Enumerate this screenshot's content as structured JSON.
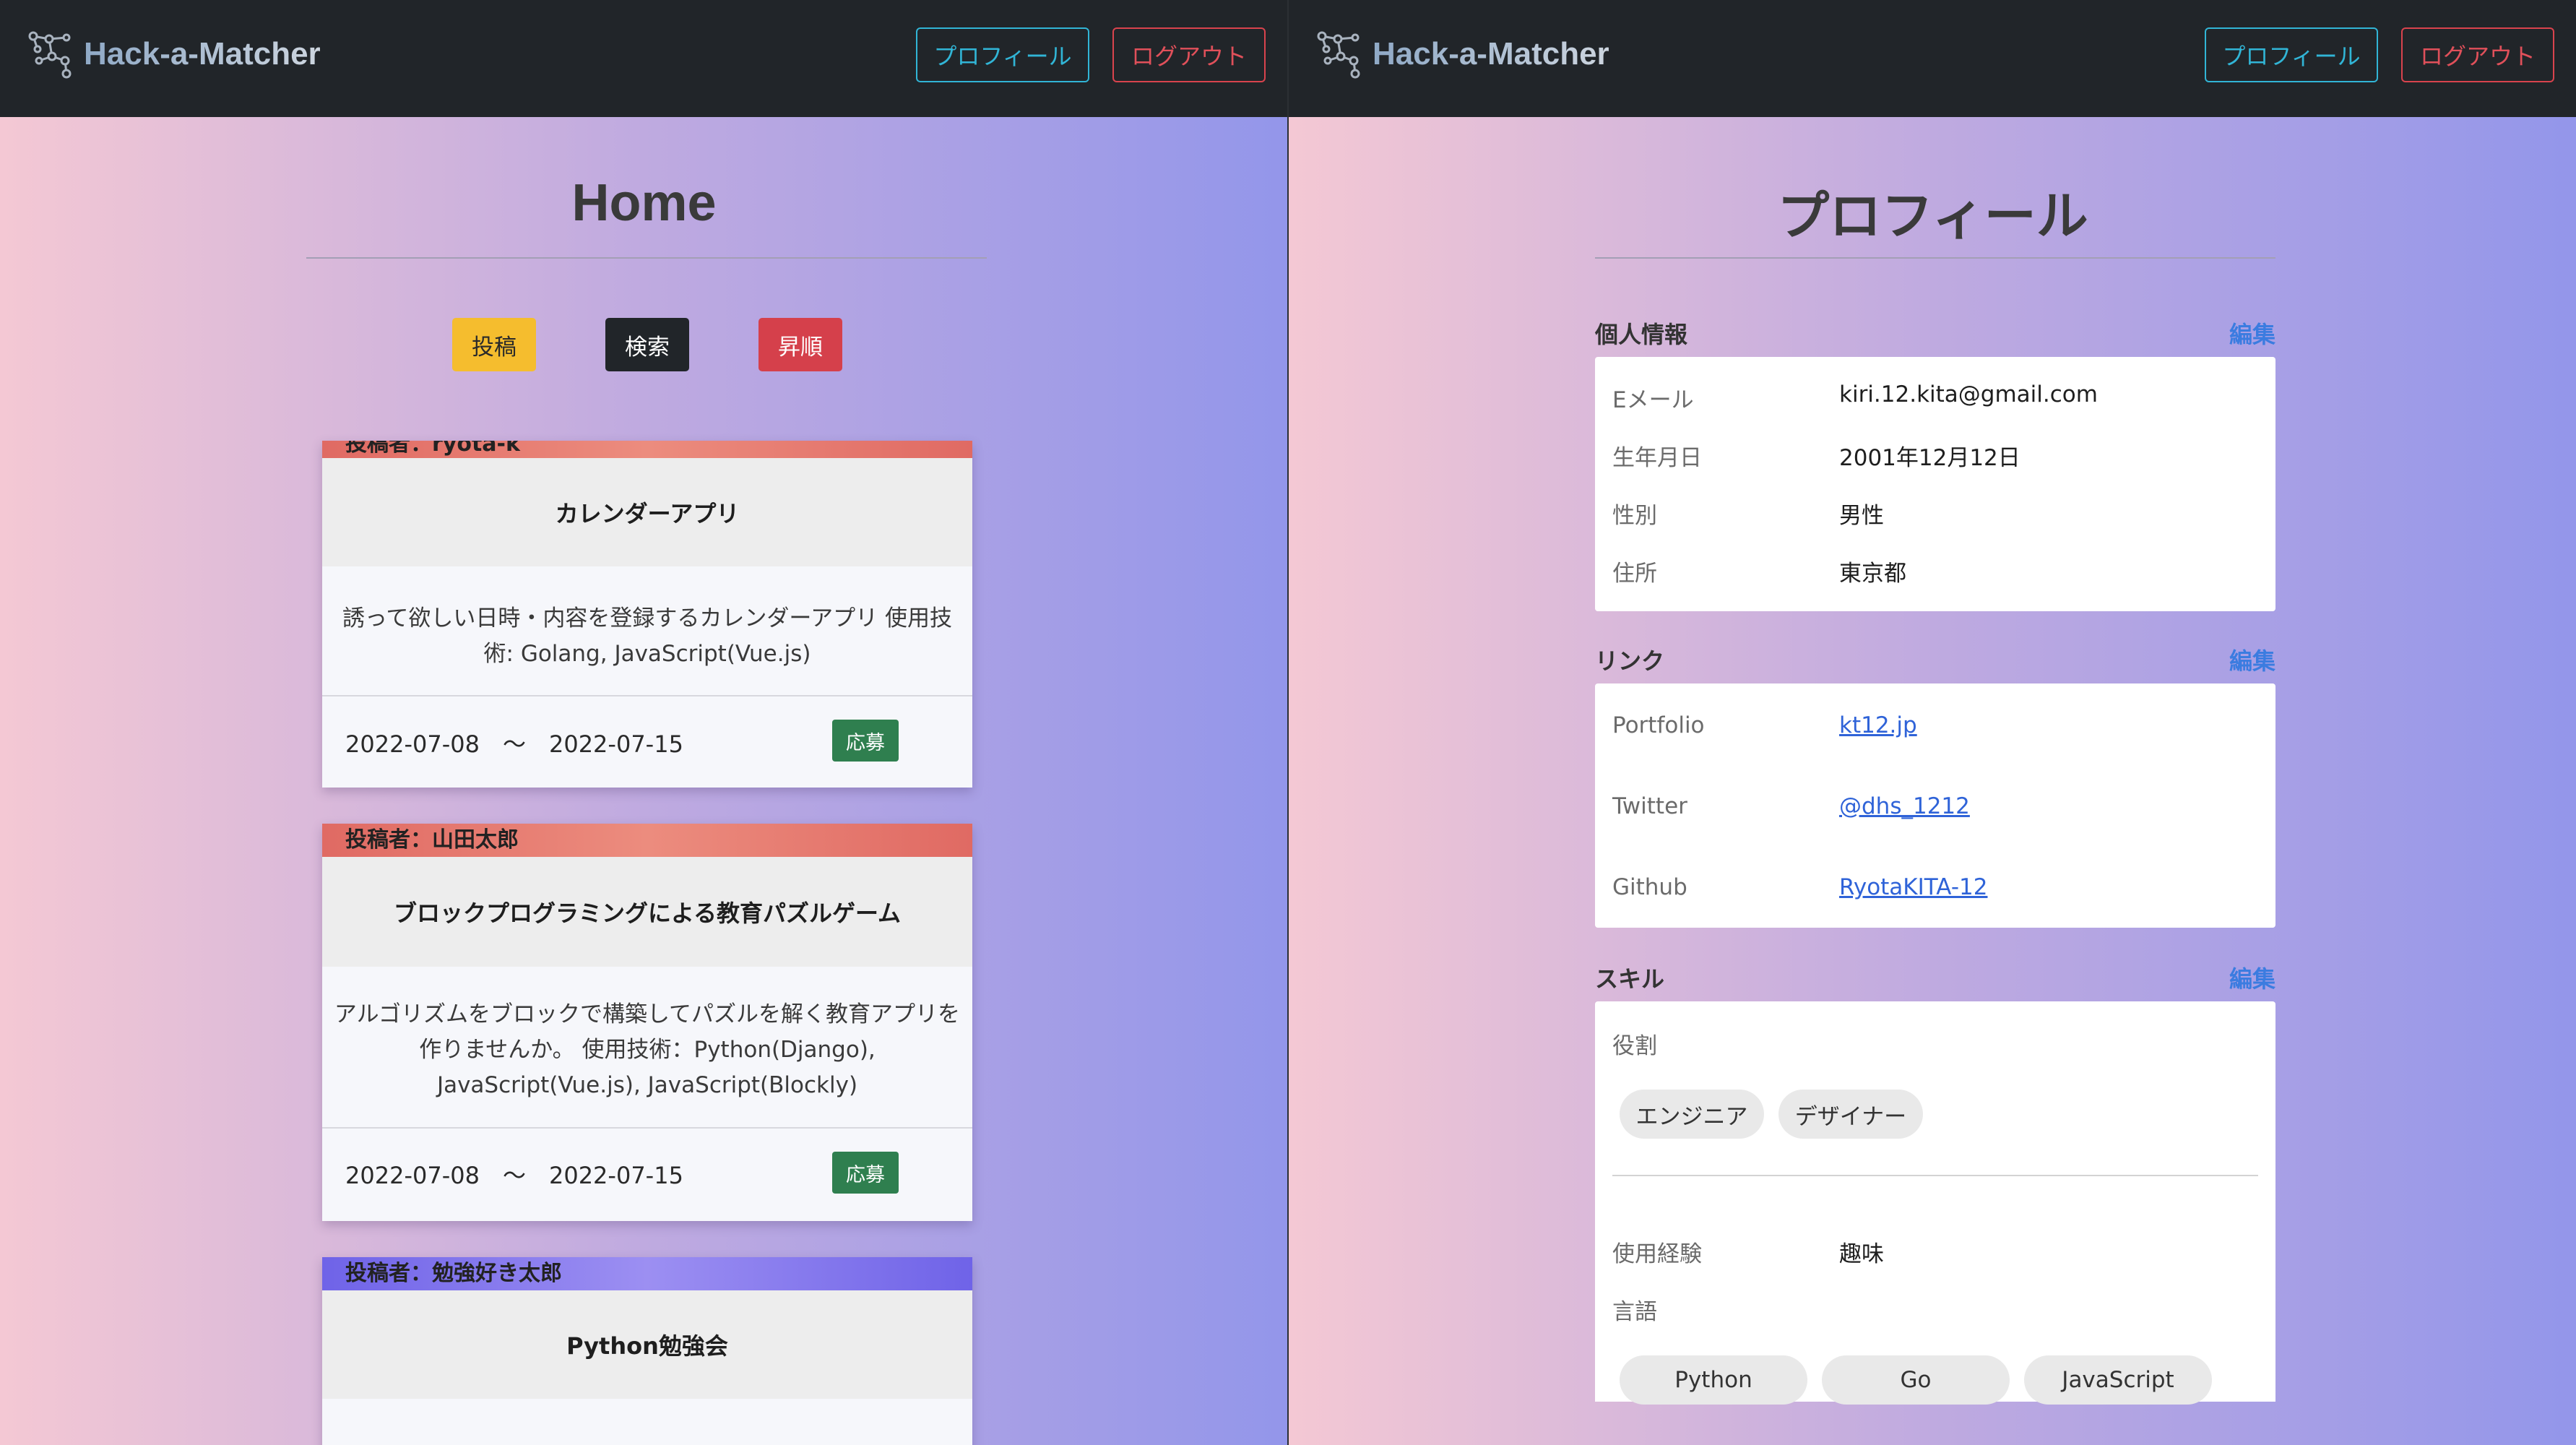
{
  "app": {
    "brand": "Hack-a-Matcher"
  },
  "nav": {
    "profile_label": "プロフィール",
    "logout_label": "ログアウト"
  },
  "home": {
    "title": "Home",
    "actions": {
      "post": "投稿",
      "search": "検索",
      "sort": "昇順"
    },
    "posts": [
      {
        "author": "投稿者：ryota-k",
        "title": "カレンダーアプリ",
        "desc_lines": [
          "誘って欲しい日時・内容を登録するカレンダーアプリ 使用技",
          "術: Golang, JavaScript(Vue.js)"
        ],
        "date_range": "2022-07-08　〜　2022-07-15",
        "apply": "応募"
      },
      {
        "author": "投稿者：山田太郎",
        "title": "ブロックプログラミングによる教育パズルゲーム",
        "desc_lines": [
          "アルゴリズムをブロックで構築してパズルを解く教育アプリを",
          "作りませんか。 使用技術：Python(Django),",
          "JavaScript(Vue.js), JavaScript(Blockly)"
        ],
        "date_range": "2022-07-08　〜　2022-07-15",
        "apply": "応募"
      },
      {
        "author": "投稿者：勉強好き太郎",
        "title": "Python勉強会"
      }
    ]
  },
  "profile": {
    "title": "プロフィール",
    "edit_label": "編集",
    "personal": {
      "label": "個人情報",
      "rows": [
        {
          "key": "Eメール",
          "value": "kiri.12.kita@gmail.com"
        },
        {
          "key": "生年月日",
          "value": "2001年12月12日"
        },
        {
          "key": "性別",
          "value": "男性"
        },
        {
          "key": "住所",
          "value": "東京都"
        }
      ]
    },
    "links": {
      "label": "リンク",
      "rows": [
        {
          "key": "Portfolio",
          "value": "kt12.jp"
        },
        {
          "key": "Twitter",
          "value": "@dhs_1212"
        },
        {
          "key": "Github",
          "value": "RyotaKITA-12"
        }
      ]
    },
    "skills": {
      "label": "スキル",
      "role_label": "役割",
      "roles": [
        "エンジニア",
        "デザイナー"
      ],
      "experience_key": "使用経験",
      "experience_value": "趣味",
      "languages_label": "言語",
      "languages": [
        "Python",
        "Go",
        "JavaScript"
      ]
    }
  },
  "colors": {
    "navbar": "#212529",
    "profile_button": "#31b5d6",
    "logout_button": "#d9434d",
    "post_button": "#f5bd2e",
    "sort_button": "#d5404b",
    "apply_button": "#2f7f4f",
    "edit_link": "#3b7ce0"
  }
}
